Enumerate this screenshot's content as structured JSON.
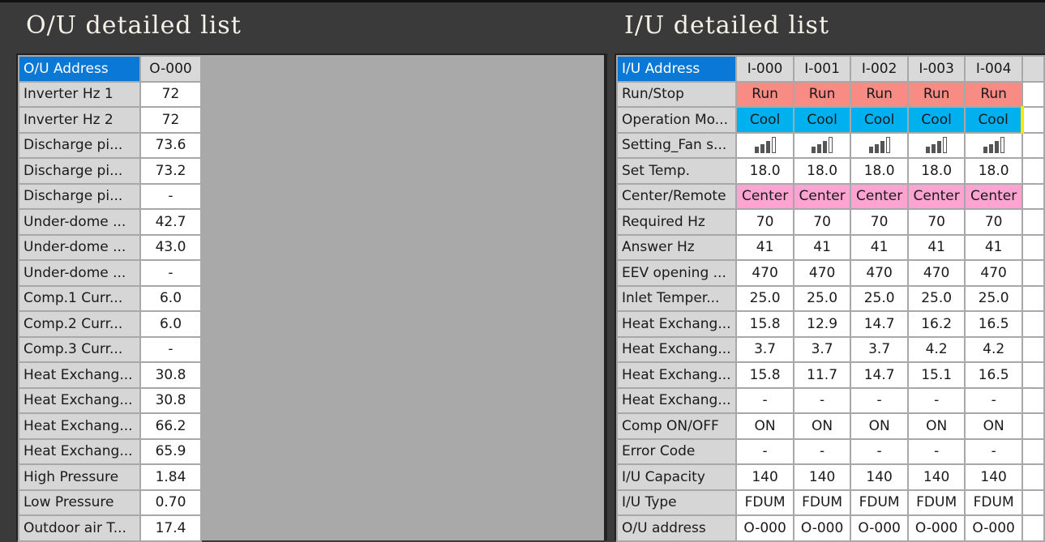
{
  "ou": {
    "title": "O/U detailed list",
    "header": {
      "label": "O/U Address",
      "value": "O-000"
    },
    "rows": [
      {
        "label": "Inverter Hz 1",
        "value": "72"
      },
      {
        "label": "Inverter Hz 2",
        "value": "72"
      },
      {
        "label": "Discharge pi...",
        "value": "73.6"
      },
      {
        "label": "Discharge pi...",
        "value": "73.2"
      },
      {
        "label": "Discharge pi...",
        "value": "-"
      },
      {
        "label": "Under-dome ...",
        "value": "42.7"
      },
      {
        "label": "Under-dome ...",
        "value": "43.0"
      },
      {
        "label": "Under-dome ...",
        "value": "-"
      },
      {
        "label": "Comp.1 Curr...",
        "value": "6.0"
      },
      {
        "label": "Comp.2 Curr...",
        "value": "6.0"
      },
      {
        "label": "Comp.3 Curr...",
        "value": "-"
      },
      {
        "label": "Heat Exchang...",
        "value": "30.8"
      },
      {
        "label": "Heat Exchang...",
        "value": "30.8"
      },
      {
        "label": "Heat Exchang...",
        "value": "66.2"
      },
      {
        "label": "Heat Exchang...",
        "value": "65.9"
      },
      {
        "label": "High Pressure",
        "value": "1.84"
      },
      {
        "label": "Low Pressure",
        "value": "0.70"
      },
      {
        "label": "Outdoor air T...",
        "value": "17.4"
      }
    ]
  },
  "iu": {
    "title": "I/U detailed list",
    "header": {
      "label": "I/U Address",
      "values": [
        "I-000",
        "I-001",
        "I-002",
        "I-003",
        "I-004"
      ]
    },
    "rows": [
      {
        "label": "Run/Stop",
        "style": "run",
        "values": [
          "Run",
          "Run",
          "Run",
          "Run",
          "Run"
        ]
      },
      {
        "label": "Operation Mo...",
        "style": "cool",
        "values": [
          "Cool",
          "Cool",
          "Cool",
          "Cool",
          "Cool"
        ]
      },
      {
        "label": "Setting_Fan s...",
        "style": "fan",
        "fan_level": "3/4",
        "values": [
          "",
          "",
          "",
          "",
          ""
        ]
      },
      {
        "label": "Set Temp.",
        "values": [
          "18.0",
          "18.0",
          "18.0",
          "18.0",
          "18.0"
        ]
      },
      {
        "label": "Center/Remote",
        "style": "center",
        "values": [
          "Center",
          "Center",
          "Center",
          "Center",
          "Center"
        ]
      },
      {
        "label": "Required Hz",
        "values": [
          "70",
          "70",
          "70",
          "70",
          "70"
        ]
      },
      {
        "label": "Answer Hz",
        "values": [
          "41",
          "41",
          "41",
          "41",
          "41"
        ]
      },
      {
        "label": "EEV opening ...",
        "values": [
          "470",
          "470",
          "470",
          "470",
          "470"
        ]
      },
      {
        "label": "Inlet Temper...",
        "values": [
          "25.0",
          "25.0",
          "25.0",
          "25.0",
          "25.0"
        ]
      },
      {
        "label": "Heat Exchang...",
        "values": [
          "15.8",
          "12.9",
          "14.7",
          "16.2",
          "16.5"
        ]
      },
      {
        "label": "Heat Exchang...",
        "values": [
          "3.7",
          "3.7",
          "3.7",
          "4.2",
          "4.2"
        ]
      },
      {
        "label": "Heat Exchang...",
        "values": [
          "15.8",
          "11.7",
          "14.7",
          "15.1",
          "16.5"
        ]
      },
      {
        "label": "Heat Exchang...",
        "values": [
          "-",
          "-",
          "-",
          "-",
          "-"
        ]
      },
      {
        "label": "Comp ON/OFF",
        "values": [
          "ON",
          "ON",
          "ON",
          "ON",
          "ON"
        ]
      },
      {
        "label": "Error Code",
        "values": [
          "-",
          "-",
          "-",
          "-",
          "-"
        ]
      },
      {
        "label": "I/U Capacity",
        "values": [
          "140",
          "140",
          "140",
          "140",
          "140"
        ]
      },
      {
        "label": "I/U Type",
        "values": [
          "FDUM",
          "FDUM",
          "FDUM",
          "FDUM",
          "FDUM"
        ]
      },
      {
        "label": "O/U address",
        "values": [
          "O-000",
          "O-000",
          "O-000",
          "O-000",
          "O-000"
        ]
      }
    ]
  },
  "colors": {
    "header_blue": "#0a78d6",
    "run": "#f88b84",
    "cool": "#00b0ef",
    "center": "#ffa3d2"
  }
}
